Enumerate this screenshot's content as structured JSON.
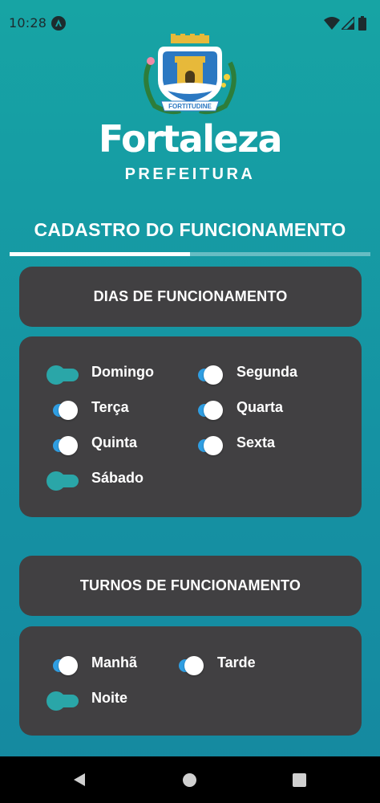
{
  "status_bar": {
    "time": "10:28"
  },
  "logo": {
    "crest_motto": "FORTITUDINE",
    "name": "Fortaleza",
    "subtitle": "PREFEITURA"
  },
  "page": {
    "title": "CADASTRO DO FUNCIONAMENTO",
    "progress": 0.5
  },
  "dias": {
    "header": "DIAS DE FUNCIONAMENTO",
    "items": [
      {
        "label": "Domingo",
        "on": false
      },
      {
        "label": "Segunda",
        "on": true
      },
      {
        "label": "Terça",
        "on": true
      },
      {
        "label": "Quarta",
        "on": true
      },
      {
        "label": "Quinta",
        "on": true
      },
      {
        "label": "Sexta",
        "on": true
      },
      {
        "label": "Sábado",
        "on": false
      }
    ]
  },
  "turnos": {
    "header": "TURNOS DE FUNCIONAMENTO",
    "items": [
      {
        "label": "Manhã",
        "on": true
      },
      {
        "label": "Tarde",
        "on": true
      },
      {
        "label": "Noite",
        "on": false
      }
    ]
  },
  "colors": {
    "background": "#1597a3",
    "card": "#414042",
    "switch_on": "#2f9ee2",
    "switch_off": "#2aa6a8"
  },
  "icons": {
    "status": [
      "android-app-icon",
      "wifi-icon",
      "signal-icon",
      "battery-icon"
    ],
    "nav": [
      "back-icon",
      "home-icon",
      "recents-icon"
    ]
  }
}
